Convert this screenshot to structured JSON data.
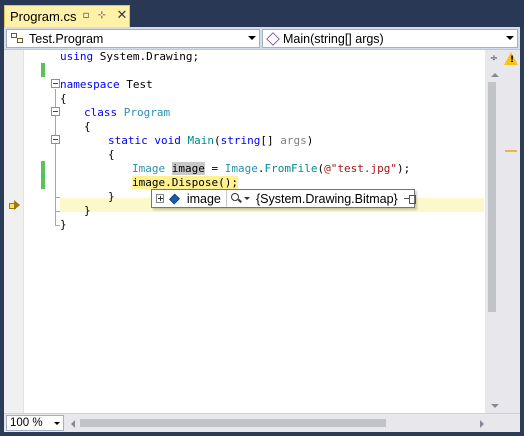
{
  "tab": {
    "title": "Program.cs",
    "pin_glyph": "▫",
    "float_glyph": "⊹",
    "close_glyph": "✕"
  },
  "navbar": {
    "type_combo": "Test.Program",
    "member_combo": "Main(string[] args)"
  },
  "code": {
    "line1": {
      "using_kw": "using",
      "rest": " System.Drawing;"
    },
    "line3": {
      "kw": "namespace",
      "rest": " Test"
    },
    "line4": "{",
    "line5": {
      "kw": "class",
      "name": " Program"
    },
    "line6": "{",
    "line7": {
      "static_kw": "static",
      "void_kw": " void",
      "method": " Main",
      "open": "(",
      "string_kw": "string",
      "args_rest": "[] ",
      "args": "args",
      "close": ")"
    },
    "line8": "{",
    "line9": {
      "type": "Image",
      "sp": " ",
      "var": "image",
      "eq": " = ",
      "type2": "Image",
      "dot": ".",
      "method": "FromFile",
      "open": "(",
      "str": "@\"test.jpg\"",
      "close": ");"
    },
    "line10": {
      "var": "image",
      "call": ".Dispose();"
    },
    "line11": "}",
    "line12": "}",
    "line13": "}"
  },
  "datatip": {
    "name": "image",
    "value": "{System.Drawing.Bitmap}"
  },
  "scroll": {
    "split_glyph": "÷",
    "warn_glyph": "!"
  },
  "zoom": {
    "level": "100 %"
  },
  "colors": {
    "tab_active": "#fff1a8",
    "keyword": "#0000ff",
    "type": "#2b91af",
    "string": "#a31515",
    "current_statement": "#fff192",
    "change_bar": "#58c35a"
  }
}
